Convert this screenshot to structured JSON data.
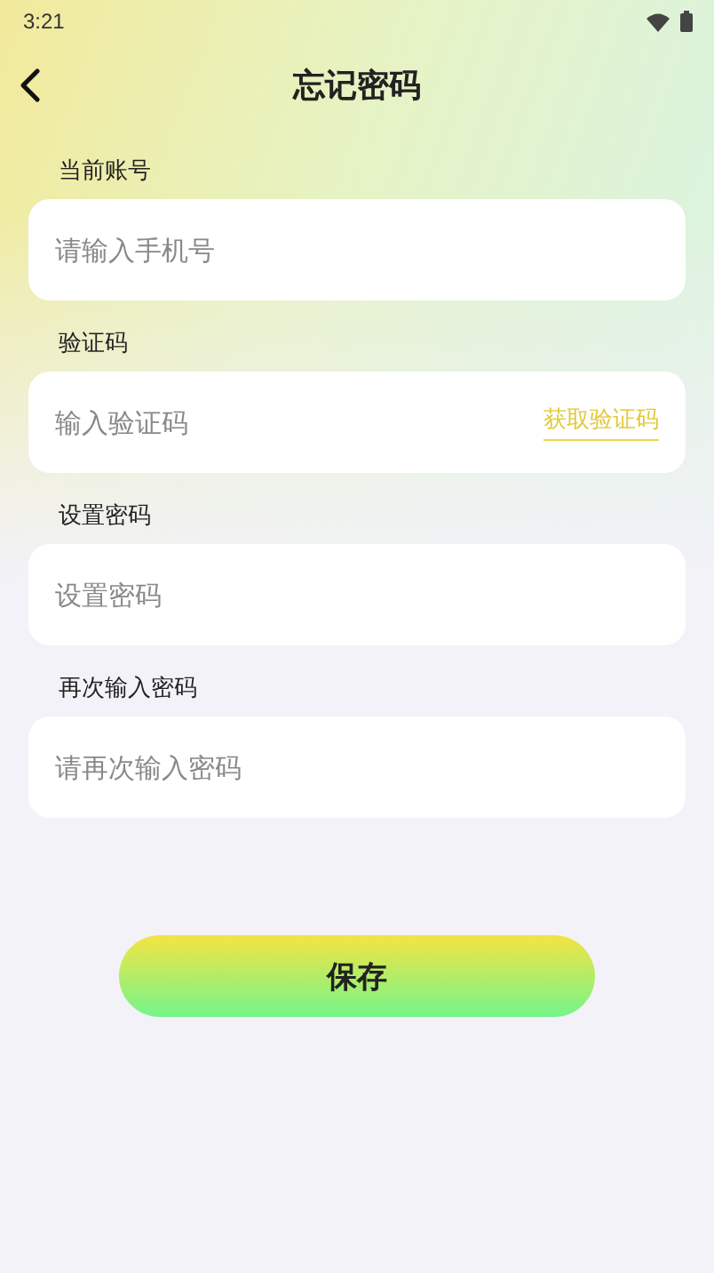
{
  "status_bar": {
    "time": "3:21"
  },
  "header": {
    "title": "忘记密码"
  },
  "fields": [
    {
      "kind": "text",
      "label": "当前账号",
      "placeholder": "请输入手机号"
    },
    {
      "kind": "code",
      "label": "验证码",
      "placeholder": "输入验证码",
      "action": "获取验证码"
    },
    {
      "kind": "text",
      "label": "设置密码",
      "placeholder": "设置密码"
    },
    {
      "kind": "text",
      "label": "再次输入密码",
      "placeholder": "请再次输入密码"
    }
  ],
  "save_button": {
    "label": "保存"
  }
}
